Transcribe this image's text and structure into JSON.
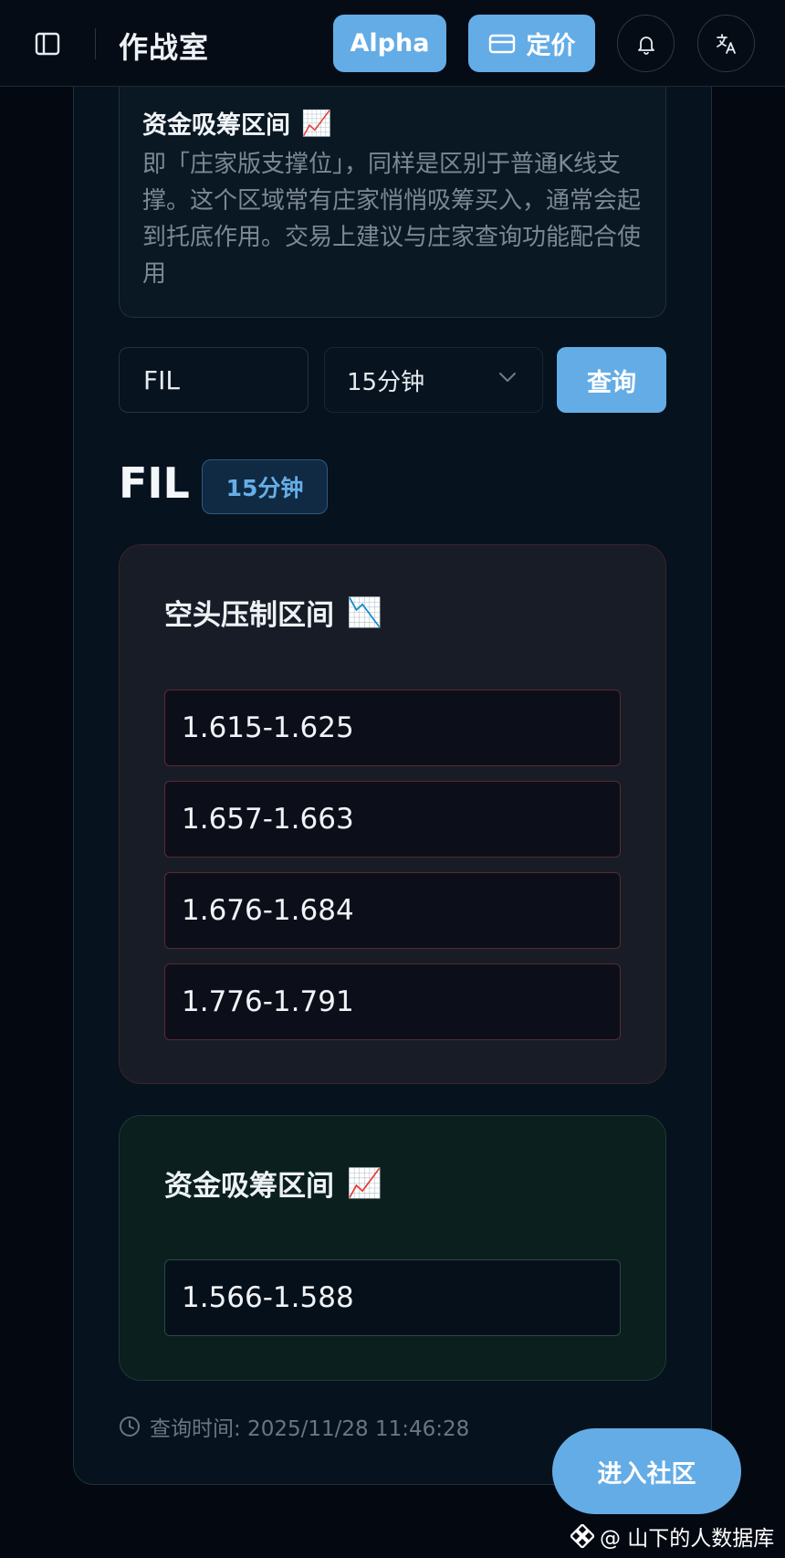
{
  "header": {
    "title": "作战室",
    "alpha_label": "Alpha",
    "pricing_label": "定价",
    "icons": [
      "sidebar-icon",
      "card-icon",
      "bell-icon",
      "translate-icon"
    ]
  },
  "description": {
    "title": "资金吸筹区间",
    "title_emoji": "📈",
    "text": "即「庄家版支撑位」，同样是区别于普通K线支撑。这个区域常有庄家悄悄吸筹买入，通常会起到托底作用。交易上建议与庄家查询功能配合使用"
  },
  "query": {
    "symbol_value": "FIL",
    "interval_value": "15分钟",
    "submit_label": "查询"
  },
  "result": {
    "symbol": "FIL",
    "interval_badge": "15分钟",
    "bear_zone": {
      "title": "空头压制区间",
      "emoji": "📉",
      "ranges": [
        "1.615-1.625",
        "1.657-1.663",
        "1.676-1.684",
        "1.776-1.791"
      ]
    },
    "bull_zone": {
      "title": "资金吸筹区间",
      "emoji": "📈",
      "ranges": [
        "1.566-1.588"
      ]
    },
    "query_time_label": "查询时间: 2025/11/28 11:46:28"
  },
  "community_button": "进入社区",
  "watermark": "@ 山下的人数据库",
  "colors": {
    "accent": "#64ace6",
    "background": "#030811",
    "bear_border": "#5a2a30",
    "bull_border": "#2c4a40"
  }
}
